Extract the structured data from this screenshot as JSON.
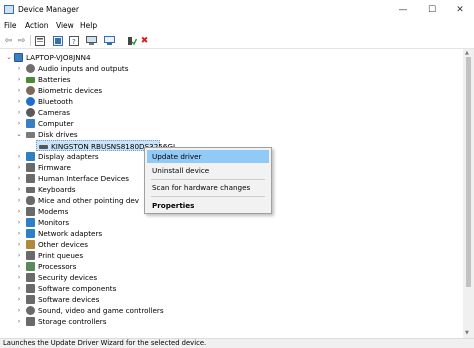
{
  "window": {
    "title": "Device Manager",
    "controls": {
      "minimize": "—",
      "maximize": "☐",
      "close": "✕"
    }
  },
  "menu": [
    "File",
    "Action",
    "View",
    "Help"
  ],
  "toolbar": {
    "icons": [
      "back-arrow-icon",
      "forward-arrow-icon",
      "properties-icon",
      "update-driver-icon",
      "help-icon",
      "device-view-icon",
      "scan-hardware-icon",
      "enable-device-icon",
      "uninstall-device-icon"
    ]
  },
  "tree": {
    "root": "LAPTOP-VJO8JNN4",
    "categories": [
      {
        "label": "Audio inputs and outputs",
        "color": "#6e6e6e"
      },
      {
        "label": "Batteries",
        "color": "#4a8a3a"
      },
      {
        "label": "Biometric devices",
        "color": "#7a6a5a"
      },
      {
        "label": "Bluetooth",
        "color": "#1f6fd1"
      },
      {
        "label": "Cameras",
        "color": "#5a5a5a"
      },
      {
        "label": "Computer",
        "color": "#3a7fc1"
      },
      {
        "label": "Disk drives",
        "color": "#7a7a7a",
        "expanded": true
      },
      {
        "label": "Display adapters",
        "color": "#2f7fc5"
      },
      {
        "label": "Firmware",
        "color": "#6a6a6a"
      },
      {
        "label": "Human Interface Devices",
        "color": "#6a6a6a"
      },
      {
        "label": "Keyboards",
        "color": "#6a6a6a"
      },
      {
        "label": "Mice and other pointing dev",
        "color": "#6a6a6a"
      },
      {
        "label": "Modems",
        "color": "#6a6a6a"
      },
      {
        "label": "Monitors",
        "color": "#2f7fc5"
      },
      {
        "label": "Network adapters",
        "color": "#2f7fc5"
      },
      {
        "label": "Other devices",
        "color": "#b08a3a"
      },
      {
        "label": "Print queues",
        "color": "#6a6a6a"
      },
      {
        "label": "Processors",
        "color": "#5a8a5a"
      },
      {
        "label": "Security devices",
        "color": "#6a6a6a"
      },
      {
        "label": "Software components",
        "color": "#6a6a6a"
      },
      {
        "label": "Software devices",
        "color": "#6a6a6a"
      },
      {
        "label": "Sound, video and game controllers",
        "color": "#6a6a6a"
      },
      {
        "label": "Storage controllers",
        "color": "#6a6a6a"
      }
    ],
    "disk_child": "KINGSTON RBUSNS8180DS3256GJ"
  },
  "context_menu": {
    "items": [
      "Update driver",
      "Uninstall device",
      "Scan for hardware changes",
      "Properties"
    ]
  },
  "status": "Launches the Update Driver Wizard for the selected device."
}
